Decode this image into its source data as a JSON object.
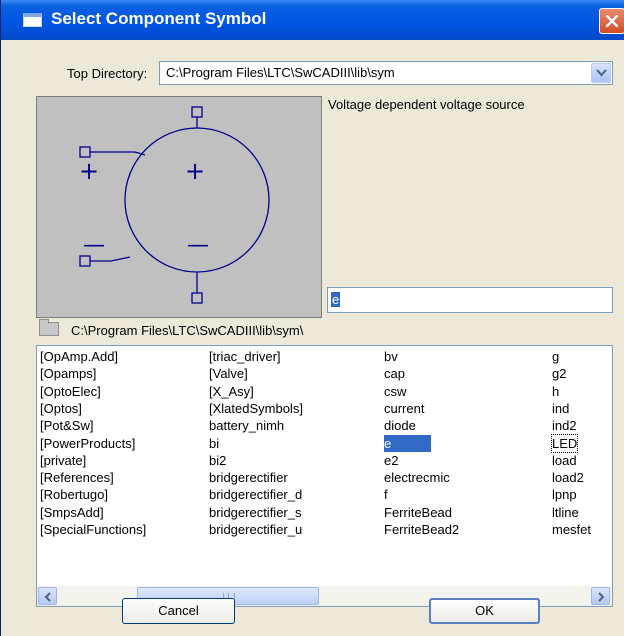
{
  "window": {
    "title": "Select Component Symbol"
  },
  "top_directory": {
    "label": "Top Directory:",
    "value": "C:\\Program Files\\LTC\\SwCADIII\\lib\\sym"
  },
  "preview": {
    "description": "Voltage dependent voltage source",
    "plus_glyph": "+",
    "minus_glyph": "—"
  },
  "filter": {
    "value": "e"
  },
  "current_path": "C:\\Program Files\\LTC\\SwCADIII\\lib\\sym\\",
  "list": {
    "columns": [
      [
        "[OpAmp.Add]",
        "[Opamps]",
        "[OptoElec]",
        "[Optos]",
        "[Pot&Sw]",
        "[PowerProducts]",
        "[private]",
        "[References]",
        "[Robertugo]",
        "[SmpsAdd]",
        "[SpecialFunctions]"
      ],
      [
        "[triac_driver]",
        "[Valve]",
        "[X_Asy]",
        "[XlatedSymbols]",
        "battery_nimh",
        "bi",
        "bi2",
        "bridgerectifier",
        "bridgerectifier_d",
        "bridgerectifier_s",
        "bridgerectifier_u"
      ],
      [
        "bv",
        "cap",
        "csw",
        "current",
        "diode",
        "e",
        "e2",
        "electrecmic",
        "f",
        "FerriteBead",
        "FerriteBead2"
      ],
      [
        "g",
        "g2",
        "h",
        "ind",
        "ind2",
        "LED",
        "load",
        "load2",
        "lpnp",
        "ltline",
        "mesfet"
      ]
    ],
    "selected": "e",
    "focused": "LED"
  },
  "buttons": {
    "cancel": "Cancel",
    "ok": "OK"
  },
  "icons": [
    "window-icon",
    "close-icon",
    "dropdown-arrow-icon",
    "folder-icon",
    "scroll-left-icon",
    "scroll-right-icon"
  ],
  "colors": {
    "titlebar": "#0054e3",
    "selection": "#316ac5",
    "symbol_stroke": "#00008b",
    "preview_bg": "#c0c0c0",
    "close": "#d44a25"
  }
}
